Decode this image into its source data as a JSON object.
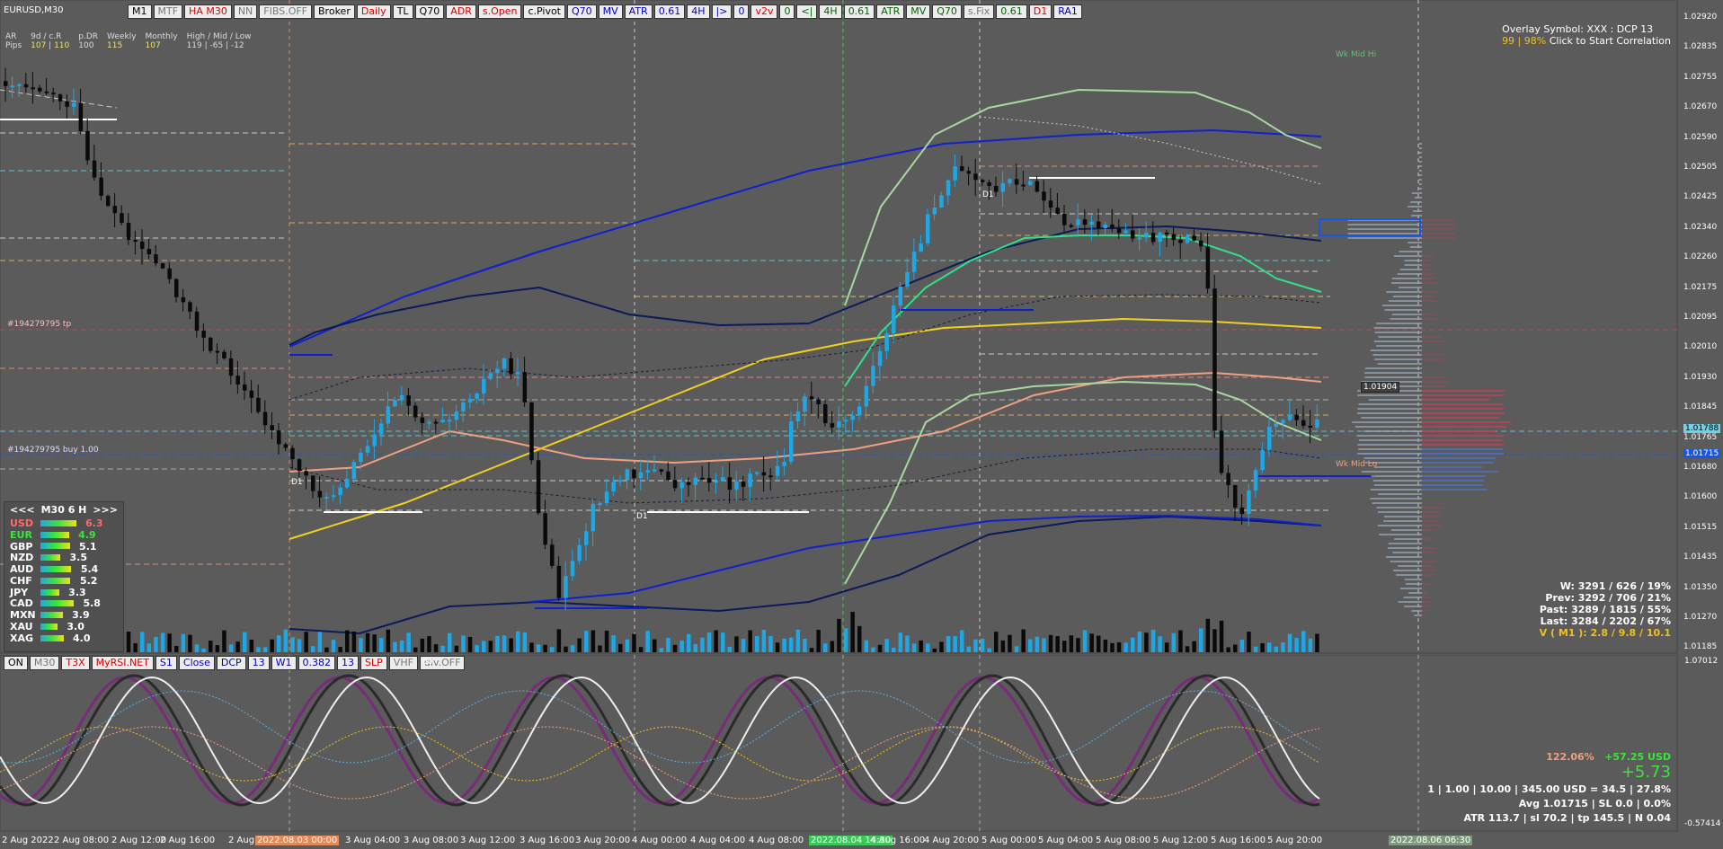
{
  "symbol": "EURUSD,M30",
  "toolbar": [
    "M1",
    "MTF",
    "HA M30",
    "NN",
    "FIBS.OFF",
    "Broker",
    "Daily",
    "TL",
    "Q70",
    "ADR",
    "s.Open",
    "c.Pivot",
    "Q70",
    "MV",
    "ATR",
    "0.61",
    "4H",
    "|>",
    "0",
    "v2v",
    "0",
    "<|",
    "4H",
    "0.61",
    "ATR",
    "MV",
    "Q70",
    "s.Fix",
    "0.61",
    "D1",
    "RA1"
  ],
  "toolbar_colors": [
    "#000",
    "#777",
    "#d00",
    "#777",
    "#777",
    "#000",
    "#d00",
    "#000",
    "#000",
    "#d00",
    "#d00",
    "#000",
    "#0000c8",
    "#0000c8",
    "#0000c8",
    "#0000c8",
    "#0000c8",
    "#0000c8",
    "#0000c8",
    "#d00",
    "#006400",
    "#006400",
    "#006400",
    "#006400",
    "#006400",
    "#006400",
    "#006400",
    "#777",
    "#006400",
    "#d00",
    "#0000c8"
  ],
  "toolbar2": [
    "ON",
    "M30",
    "T3X",
    "MyRSI.NET",
    "S1",
    "Close",
    "DCP",
    "13",
    "W1",
    "0.382",
    "13",
    "SLP",
    "VHF",
    "div.OFF"
  ],
  "toolbar2_colors": [
    "#000",
    "#777",
    "#d00",
    "#d00",
    "#0000c8",
    "#0000c8",
    "#0000c8",
    "#0000c8",
    "#0000c8",
    "#0000c8",
    "#0000c8",
    "#d00",
    "#777",
    "#777"
  ],
  "stats": {
    "col1": {
      "h": "AR",
      "v": "Pips"
    },
    "col2": {
      "h": "9d / c.R",
      "v": "107 | 110"
    },
    "col3": {
      "h": "p.DR",
      "v": "100"
    },
    "col4": {
      "h": "Weekly",
      "v": "115"
    },
    "col5": {
      "h": "Monthly",
      "v": "107"
    },
    "col6": {
      "h": "High / Mid / Low",
      "v": "119 | -65 | -12"
    }
  },
  "overlay": {
    "line1": "Overlay Symbol: XXX : DCP 13",
    "line2a": "99 | 98%",
    "line2b": " Click to Start Correlation"
  },
  "wk_mid_hi": "Wk Mid Hi",
  "wk_mid_lo": "Wk Mid Lo",
  "order_tp": "#194279795 tp",
  "order_buy": "#194279795 buy 1.00",
  "price_box": "1.01904",
  "d1_labels": [
    "D1",
    "D1",
    "D1"
  ],
  "price_axis": [
    "1.02920",
    "1.02835",
    "1.02755",
    "1.02670",
    "1.02590",
    "1.02505",
    "1.02425",
    "1.02340",
    "1.02260",
    "1.02175",
    "1.02095",
    "1.02010",
    "1.01930",
    "1.01845",
    "1.01765",
    "1.01680",
    "1.01600",
    "1.01515",
    "1.01435",
    "1.01350",
    "1.01270",
    "1.01185"
  ],
  "current_price": "1.01788",
  "blue_price": "1.01715",
  "osc_axis": {
    "top": "1.07012",
    "bottom": "-0.57414"
  },
  "currency_panel": {
    "header": {
      "left": "<<<",
      "mid": "M30  6  H",
      "right": ">>>"
    },
    "rows": [
      {
        "name": "USD",
        "value": "6.3",
        "color": "#ff6a6a",
        "level": 0.9
      },
      {
        "name": "EUR",
        "value": "4.9",
        "color": "#39e639",
        "level": 0.72
      },
      {
        "name": "GBP",
        "value": "5.1",
        "color": "#ffffff",
        "level": 0.74
      },
      {
        "name": "NZD",
        "value": "3.5",
        "color": "#ffffff",
        "level": 0.5
      },
      {
        "name": "AUD",
        "value": "5.4",
        "color": "#ffffff",
        "level": 0.78
      },
      {
        "name": "CHF",
        "value": "5.2",
        "color": "#ffffff",
        "level": 0.76
      },
      {
        "name": "JPY",
        "value": "3.3",
        "color": "#ffffff",
        "level": 0.47
      },
      {
        "name": "CAD",
        "value": "5.8",
        "color": "#ffffff",
        "level": 0.84
      },
      {
        "name": "MXN",
        "value": "3.9",
        "color": "#ffffff",
        "level": 0.56
      },
      {
        "name": "XAU",
        "value": "3.0",
        "color": "#ffffff",
        "level": 0.43
      },
      {
        "name": "XAG",
        "value": "4.0",
        "color": "#ffffff",
        "level": 0.58
      }
    ]
  },
  "right_stats": {
    "w": "W: 3291 / 626 / 19%",
    "prev": "Prev: 3292 / 706 / 21%",
    "past": "Past: 3289 / 1815 / 55%",
    "last": "Last: 3284 / 2202 / 67%",
    "v": "V ( M1 ): 2.8 / 9.8 / 10.1"
  },
  "pnl": {
    "pct": "122.06%",
    "usd": "+57.25 USD",
    "big": "+5.73",
    "line1": "1  |  1.00  |  10.00  |  345.00 USD = 34.5  |  27.8%",
    "line2": "Avg 1.01715  |  SL 0.0  |  0.0%",
    "line3": "ATR 113.7  |  sl 70.2  |  tp 145.5  |  N 0.04"
  },
  "x_labels": [
    "2 Aug 2022",
    "2 Aug 08:00",
    "2 Aug 12:00",
    "2 Aug 16:00",
    "2 Aug",
    "2022.08.03 00:00",
    "3 Aug 04:00",
    "3 Aug 08:00",
    "3 Aug 12:00",
    "3 Aug 16:00",
    "3 Aug 20:00",
    "4 Aug 00:00",
    "4 Aug 04:00",
    "4 Aug 08:00",
    "2022.08.04 14:30",
    "4 Aug 16:00",
    "4 Aug 20:00",
    "5 Aug 00:00",
    "5 Aug 04:00",
    "5 Aug 08:00",
    "5 Aug 12:00",
    "5 Aug 16:00",
    "5 Aug 20:00",
    "2022.08.06 06:30"
  ],
  "osc_small": "00",
  "colors": {
    "bull": "#1ea7e6",
    "bear": "#0a0a0a",
    "bg": "#5b5b5b",
    "yellow": "#f0d020",
    "navy": "#0a1a5a",
    "blue": "#1020d0",
    "green": "#33e08a",
    "salmon": "#f0a080",
    "lightgreen": "#a8d8a0"
  }
}
